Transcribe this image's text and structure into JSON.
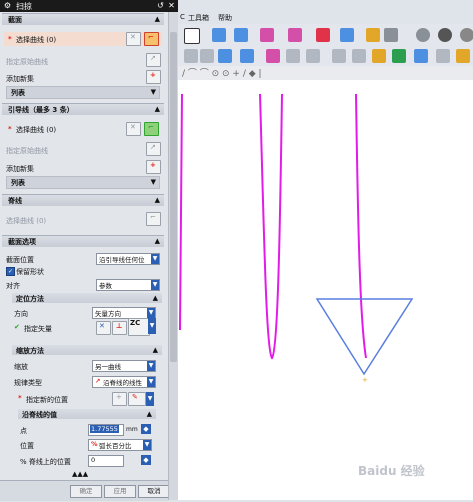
{
  "window": {
    "title": "扫掠",
    "cat_title": "C"
  },
  "menubar": {
    "items": [
      "工具箱",
      "帮助"
    ]
  },
  "sections": {
    "section_curves": {
      "title": "截面",
      "select_curve": "选择曲线 (0)",
      "specify_origin": "指定原始曲线",
      "add_new_set": "添加新集",
      "list": "列表"
    },
    "guides": {
      "title": "引导线（最多 3 条）",
      "select_curve": "选择曲线 (0)",
      "specify_origin": "指定原始曲线",
      "add_new_set": "添加新集",
      "list": "列表"
    },
    "spine": {
      "title": "脊线",
      "select_curve": "选择曲线 (0)"
    },
    "options": {
      "title": "截面选项",
      "section_position_label": "截面位置",
      "section_position_value": "沿引导线任何位",
      "keep_shape": "保留形状",
      "alignment_label": "对齐",
      "alignment_value": "参数",
      "orientation": {
        "title": "定位方法",
        "direction_label": "方向",
        "direction_value": "矢量方向",
        "specify_vector": "指定矢量",
        "vector_tag": "ZC"
      },
      "scaling": {
        "title": "缩放方法",
        "scale_label": "缩放",
        "scale_value": "另一曲线",
        "law_type_label": "规律类型",
        "law_type_value": "沿脊线的线性",
        "specify_new_position": "指定新的位置",
        "spine_values": {
          "title": "沿脊线的值",
          "point_label": "点",
          "point_value": "1.77555",
          "point_unit": "mm",
          "position_label": "位置",
          "position_value": "弧长百分比",
          "percent_label": "% 脊线上的位置",
          "percent_value": "0"
        }
      }
    }
  },
  "footer": {
    "ok": "确定",
    "apply": "应用",
    "cancel": "取消"
  },
  "watermark": "Baidu 经验",
  "colors": {
    "accent_red": "#e2241b",
    "curve_magenta": "#e21ce8",
    "triangle_blue": "#5a7fe0"
  }
}
